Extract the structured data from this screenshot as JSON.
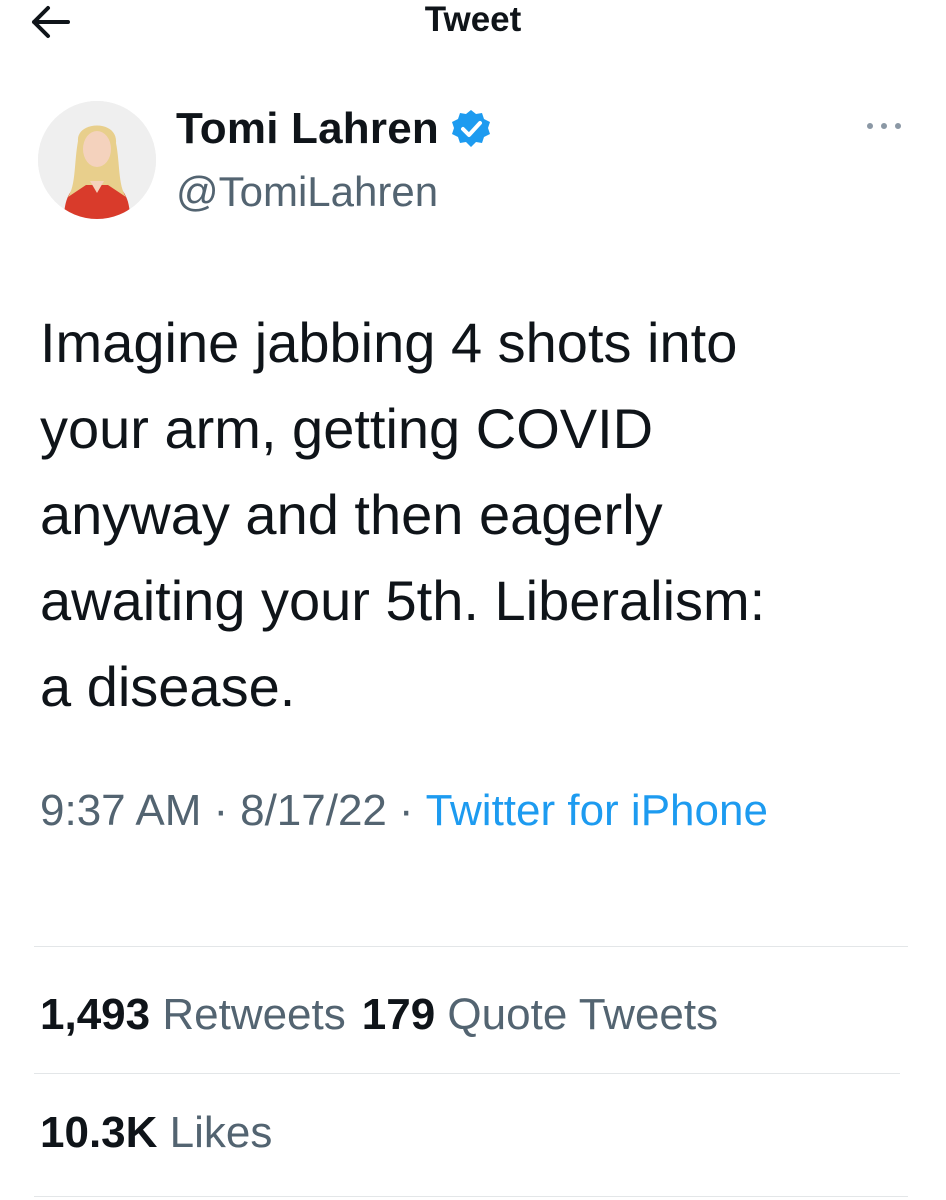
{
  "header": {
    "title": "Tweet",
    "back_icon": "arrow-left-icon"
  },
  "author": {
    "display_name": "Tomi Lahren",
    "handle": "@TomiLahren",
    "verified_icon": "verified-badge-icon",
    "more_icon": "more-dots-icon"
  },
  "tweet": {
    "text": "Imagine jabbing 4 shots into\nyour arm, getting COVID\nanyway and then eagerly\nawaiting your 5th. Liberalism:\na disease.",
    "time": "9:37 AM",
    "date": "8/17/22",
    "separator": "·",
    "source": "Twitter for iPhone"
  },
  "stats": {
    "retweets_count": "1,493",
    "retweets_label": "Retweets",
    "quotes_count": "179",
    "quotes_label": "Quote Tweets",
    "likes_count": "10.3K",
    "likes_label": "Likes"
  },
  "colors": {
    "link": "#1d9bf0",
    "secondary_text": "#536471",
    "verified": "#1d9bf0"
  }
}
